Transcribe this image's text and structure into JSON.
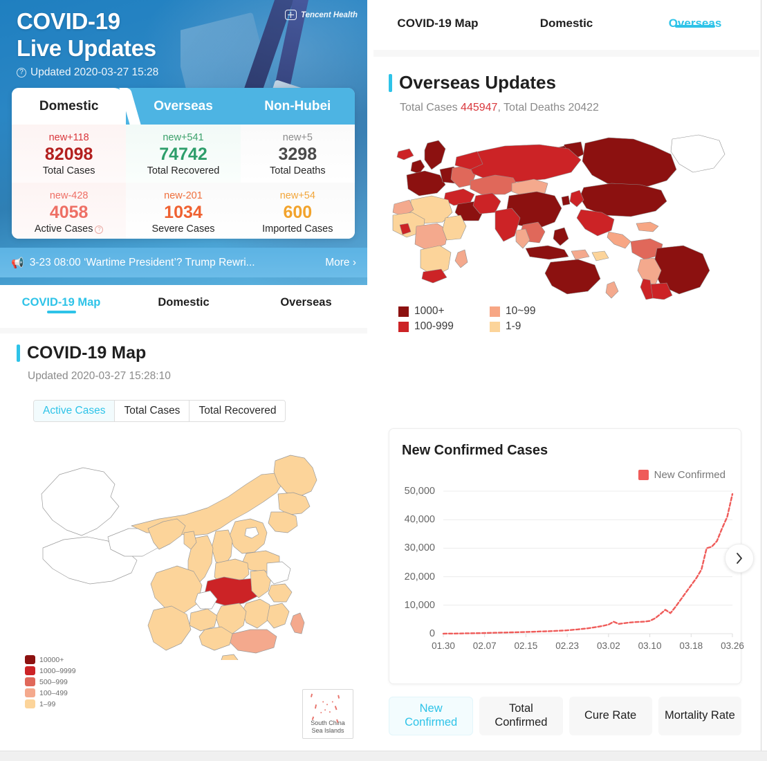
{
  "hero": {
    "title_line1": "COVID-19",
    "title_line2": "Live Updates",
    "updated": "Updated 2020-03-27 15:28",
    "help_icon": "question-circle-icon",
    "brand": "Tencent Health"
  },
  "stats_tabs": [
    {
      "label": "Domestic",
      "active": true
    },
    {
      "label": "Overseas",
      "active": false
    },
    {
      "label": "Non-Hubei",
      "active": false
    }
  ],
  "stats": [
    {
      "new": "new+118",
      "value": "82098",
      "label": "Total Cases",
      "new_color": "#d9373c",
      "value_color": "#b3201f",
      "tint": "tint-red",
      "help": false
    },
    {
      "new": "new+541",
      "value": "74742",
      "label": "Total Recovered",
      "new_color": "#3aa06a",
      "value_color": "#2e9e6b",
      "tint": "tint-green",
      "help": false
    },
    {
      "new": "new+5",
      "value": "3298",
      "label": "Total Deaths",
      "new_color": "#8c8c8c",
      "value_color": "#4a4a4a",
      "tint": "tint-gray",
      "help": false
    },
    {
      "new": "new-428",
      "value": "4058",
      "label": "Active Cases",
      "new_color": "#ee6f65",
      "value_color": "#ee6f65",
      "tint": "tint-red",
      "help": true
    },
    {
      "new": "new-201",
      "value": "1034",
      "label": "Severe Cases",
      "new_color": "#ef6f3c",
      "value_color": "#ef6131",
      "tint": "tint-gray",
      "help": false
    },
    {
      "new": "new+54",
      "value": "600",
      "label": "Imported Cases",
      "new_color": "#f2a63a",
      "value_color": "#f2a32c",
      "tint": "tint-gray",
      "help": false
    }
  ],
  "news": {
    "icon": "megaphone-icon",
    "text": "3-23 08:00 ‘Wartime President’? Trump Rewri...",
    "more": "More ›"
  },
  "left_tabs": [
    {
      "label": "COVID-19 Map",
      "active": true
    },
    {
      "label": "Domestic",
      "active": false
    },
    {
      "label": "Overseas",
      "active": false
    }
  ],
  "china_section": {
    "title": "COVID-19 Map",
    "updated": "Updated 2020-03-27 15:28:10",
    "segments": [
      {
        "label": "Active Cases",
        "active": true
      },
      {
        "label": "Total Cases",
        "active": false
      },
      {
        "label": "Total Recovered",
        "active": false
      }
    ],
    "legend": [
      {
        "label": "10000+",
        "color": "#8c1110"
      },
      {
        "label": "1000–9999",
        "color": "#cc2326"
      },
      {
        "label": "500–999",
        "color": "#e0685a"
      },
      {
        "label": "100–499",
        "color": "#f4a98d"
      },
      {
        "label": "1–99",
        "color": "#fcd49a"
      }
    ],
    "inset_label_line1": "South China",
    "inset_label_line2": "Sea Islands"
  },
  "right_tabs": [
    {
      "label": "COVID-19 Map",
      "active": false
    },
    {
      "label": "Domestic",
      "active": false
    },
    {
      "label": "Overseas",
      "active": true
    }
  ],
  "overseas": {
    "title": "Overseas Updates",
    "cases_label": "Total Cases",
    "cases_value": "445947",
    "separator": ",",
    "deaths_label": "Total Deaths",
    "deaths_value": "20422",
    "legend": [
      {
        "label": "1000+",
        "color": "#8c1110"
      },
      {
        "label": "10~99",
        "color": "#f7a684"
      },
      {
        "label": "100-999",
        "color": "#cc2326"
      },
      {
        "label": "1-9",
        "color": "#fcd49a"
      }
    ]
  },
  "chart_card": {
    "title": "New Confirmed Cases",
    "legend_label": "New Confirmed",
    "legend_color": "#ef5b59",
    "next_icon": "chevron-right-icon",
    "buttons": [
      {
        "label": "New Confirmed",
        "active": true
      },
      {
        "label": "Total Confirmed",
        "active": false
      },
      {
        "label": "Cure Rate",
        "active": false
      },
      {
        "label": "Mortality Rate",
        "active": false
      }
    ]
  },
  "chart_data": {
    "type": "line",
    "title": "New Confirmed Cases",
    "xlabel": "",
    "ylabel": "",
    "ylim": [
      0,
      50000
    ],
    "yticks": [
      "0",
      "10,000",
      "20,000",
      "30,000",
      "40,000",
      "50,000"
    ],
    "ytick_values": [
      0,
      10000,
      20000,
      30000,
      40000,
      50000
    ],
    "xticks": [
      "01.30",
      "02.07",
      "02.15",
      "02.23",
      "03.02",
      "03.10",
      "03.18",
      "03.26"
    ],
    "grid": true,
    "legend_position": "top-right",
    "series": [
      {
        "name": "New Confirmed",
        "color": "#ef5b59",
        "style": "dashed",
        "x": [
          "01.30",
          "01.31",
          "02.01",
          "02.02",
          "02.03",
          "02.04",
          "02.05",
          "02.06",
          "02.07",
          "02.08",
          "02.09",
          "02.10",
          "02.11",
          "02.12",
          "02.13",
          "02.14",
          "02.15",
          "02.16",
          "02.17",
          "02.18",
          "02.19",
          "02.20",
          "02.21",
          "02.22",
          "02.23",
          "02.24",
          "02.25",
          "02.26",
          "02.27",
          "02.28",
          "02.29",
          "03.01",
          "03.02",
          "03.03",
          "03.04",
          "03.05",
          "03.06",
          "03.07",
          "03.08",
          "03.09",
          "03.10",
          "03.11",
          "03.12",
          "03.13",
          "03.14",
          "03.15",
          "03.16",
          "03.17",
          "03.18",
          "03.19",
          "03.20",
          "03.21",
          "03.22",
          "03.23",
          "03.24",
          "03.25",
          "03.26"
        ],
        "values": [
          30,
          40,
          60,
          80,
          110,
          140,
          170,
          200,
          240,
          280,
          330,
          380,
          420,
          470,
          520,
          560,
          610,
          660,
          720,
          790,
          860,
          930,
          1010,
          1100,
          1200,
          1350,
          1500,
          1700,
          1900,
          2150,
          2450,
          2800,
          3200,
          4200,
          3450,
          3700,
          3900,
          4050,
          4150,
          4250,
          4500,
          5400,
          6800,
          8400,
          7200,
          9500,
          12000,
          14500,
          17000,
          19500,
          22500,
          30000,
          30500,
          32500,
          37000,
          41000,
          49000
        ]
      }
    ]
  }
}
